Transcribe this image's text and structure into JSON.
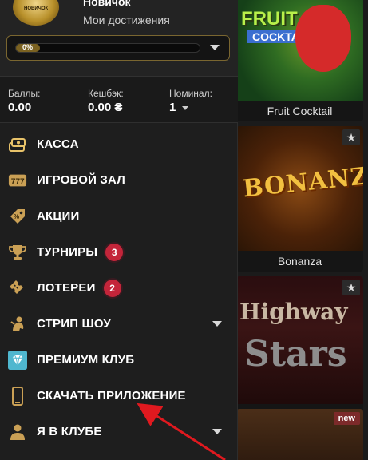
{
  "profile": {
    "rank": "Новичок",
    "achievements": "Мои достижения",
    "avatar_text": "НОВИЧОК",
    "progress_text": "0%",
    "progress_fraction": 0.1
  },
  "stats": {
    "points_label": "Баллы:",
    "points_value": "0.00",
    "cashback_label": "Кешбэк:",
    "cashback_value": "0.00 ₴",
    "nominal_label": "Номинал:",
    "nominal_value": "1"
  },
  "menu": [
    {
      "label": "КАССА",
      "icon": "cash-icon"
    },
    {
      "label": "ИГРОВОЙ ЗАЛ",
      "icon": "slot-777-icon"
    },
    {
      "label": "АКЦИИ",
      "icon": "tag-icon"
    },
    {
      "label": "ТУРНИРЫ",
      "icon": "trophy-icon",
      "badge": "3"
    },
    {
      "label": "ЛОТЕРЕИ",
      "icon": "ticket-icon",
      "badge": "2"
    },
    {
      "label": "СТРИП ШОУ",
      "icon": "strip-show-icon",
      "expandable": true
    },
    {
      "label": "ПРЕМИУМ КЛУБ",
      "icon": "diamond-icon"
    },
    {
      "label": "СКАЧАТЬ ПРИЛОЖЕНИЕ",
      "icon": "phone-icon"
    },
    {
      "label": "Я В КЛУБЕ",
      "icon": "user-icon",
      "expandable": true
    }
  ],
  "games": [
    {
      "title": "Fruit Cocktail",
      "art_line1": "FRUIT",
      "art_line2": "COCKTAIL"
    },
    {
      "title": "Bonanza",
      "art_line1": "BONANZA"
    },
    {
      "title": "Highway Stars",
      "art_line1": "Highway",
      "art_line2": "Stars"
    },
    {
      "badge": "new"
    }
  ],
  "colors": {
    "accent_gold": "#7b6221",
    "badge_red": "#c4253a",
    "annotation_arrow": "#e0191f"
  }
}
